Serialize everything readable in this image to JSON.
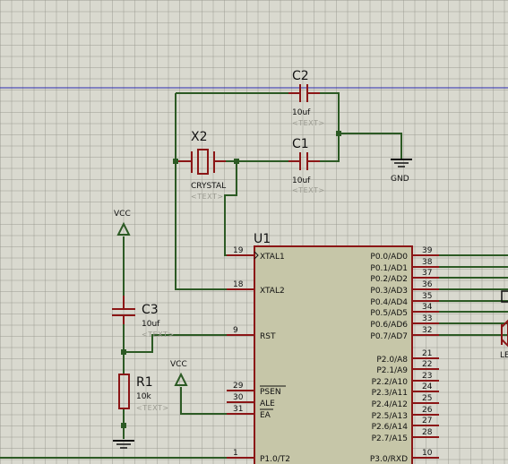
{
  "components": {
    "c2": {
      "ref": "C2",
      "value": "10uf",
      "text": "<TEXT>"
    },
    "c1": {
      "ref": "C1",
      "value": "10uf",
      "text": "<TEXT>"
    },
    "x2": {
      "ref": "X2",
      "value": "CRYSTAL",
      "text": "<TEXT>"
    },
    "c3": {
      "ref": "C3",
      "value": "10uf",
      "text": "<TEXT>"
    },
    "r1": {
      "ref": "R1",
      "value": "10k",
      "text": "<TEXT>"
    },
    "u1": {
      "ref": "U1"
    }
  },
  "power": {
    "vcc1": "VCC",
    "vcc2": "VCC",
    "gnd": "GND"
  },
  "u1_left_pins": [
    {
      "num": "19",
      "name": "XTAL1"
    },
    {
      "num": "18",
      "name": "XTAL2"
    },
    {
      "num": "9",
      "name": "RST"
    },
    {
      "num": "29",
      "name": "PSEN"
    },
    {
      "num": "30",
      "name": "ALE"
    },
    {
      "num": "31",
      "name": "EA"
    },
    {
      "num": "1",
      "name": "P1.0/T2"
    }
  ],
  "u1_right_pins": [
    {
      "num": "39",
      "name": "P0.0/AD0"
    },
    {
      "num": "38",
      "name": "P0.1/AD1"
    },
    {
      "num": "37",
      "name": "P0.2/AD2"
    },
    {
      "num": "36",
      "name": "P0.3/AD3"
    },
    {
      "num": "35",
      "name": "P0.4/AD4"
    },
    {
      "num": "34",
      "name": "P0.5/AD5"
    },
    {
      "num": "33",
      "name": "P0.6/AD6"
    },
    {
      "num": "32",
      "name": "P0.7/AD7"
    },
    {
      "num": "21",
      "name": "P2.0/A8"
    },
    {
      "num": "22",
      "name": "P2.1/A9"
    },
    {
      "num": "23",
      "name": "P2.2/A10"
    },
    {
      "num": "24",
      "name": "P2.3/A11"
    },
    {
      "num": "25",
      "name": "P2.4/A12"
    },
    {
      "num": "26",
      "name": "P2.5/A13"
    },
    {
      "num": "27",
      "name": "P2.6/A14"
    },
    {
      "num": "28",
      "name": "P2.7/A15"
    },
    {
      "num": "10",
      "name": "P3.0/RXD"
    }
  ],
  "offscreen_label": "LE"
}
